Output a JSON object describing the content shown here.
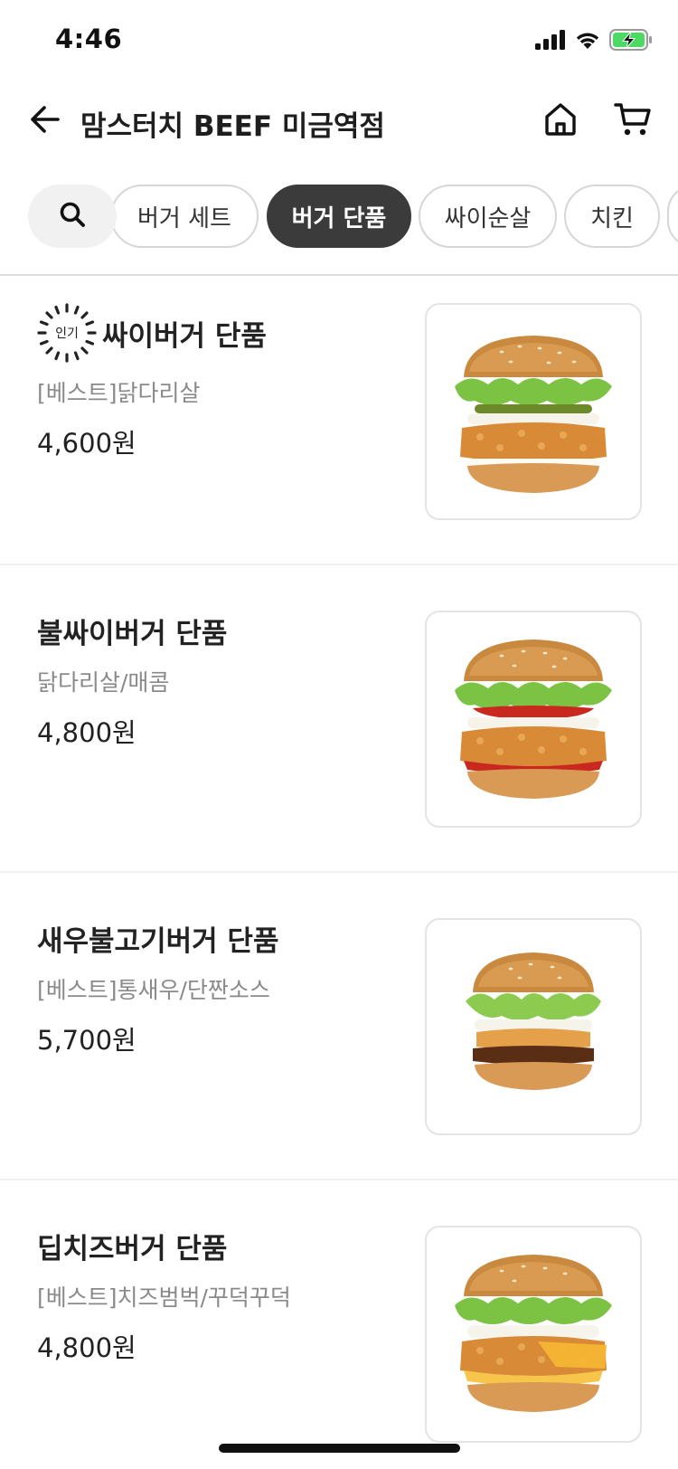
{
  "status_bar": {
    "time": "4:46",
    "icons": [
      "signal-icon",
      "wifi-icon",
      "battery-charging-icon"
    ],
    "battery_color": "#4cd964"
  },
  "header": {
    "title": "맘스터치 BEEF 미금역점",
    "back_icon": "back-arrow-icon",
    "home_icon": "home-icon",
    "cart_icon": "cart-icon"
  },
  "categories": {
    "search_icon": "search-icon",
    "chips": [
      {
        "label": "버거 세트",
        "active": false
      },
      {
        "label": "버거 단품",
        "active": true
      },
      {
        "label": "싸이순살",
        "active": false
      },
      {
        "label": "치킨",
        "active": false
      }
    ]
  },
  "menu": {
    "items": [
      {
        "badge": "인기",
        "name": "싸이버거 단품",
        "desc": "[베스트]닭다리살",
        "price": "4,600원",
        "image": "cheese-free fried chicken burger"
      },
      {
        "badge": "",
        "name": "불싸이버거 단품",
        "desc": "닭다리살/매콤",
        "price": "4,800원",
        "image": "spicy fried chicken burger"
      },
      {
        "badge": "",
        "name": "새우불고기버거 단품",
        "desc": "[베스트]통새우/단짠소스",
        "price": "5,700원",
        "image": "shrimp bulgogi burger"
      },
      {
        "badge": "",
        "name": "딥치즈버거 단품",
        "desc": "[베스트]치즈범벅/꾸덕꾸덕",
        "price": "4,800원",
        "image": "deep cheese chicken burger"
      }
    ]
  },
  "colors": {
    "active_chip": "#3b3b3b",
    "chip_border": "#d6d6d6",
    "desc_text": "#8a8a8a"
  }
}
